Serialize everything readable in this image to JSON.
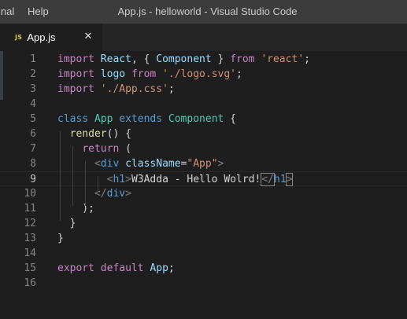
{
  "titlebar": {
    "menu_terminal": "inal",
    "menu_help": "Help",
    "window_title": "App.js - helloworld - Visual Studio Code"
  },
  "tab": {
    "icon_text": "JS",
    "label": "App.js",
    "close_glyph": "✕",
    "icon_color": "#cbcb41"
  },
  "editor": {
    "active_line": 9,
    "lines": [
      {
        "n": "1",
        "tokens": [
          [
            "kw2",
            "import"
          ],
          [
            "p",
            " "
          ],
          [
            "id",
            "React"
          ],
          [
            "p",
            ", { "
          ],
          [
            "id",
            "Component"
          ],
          [
            "p",
            " } "
          ],
          [
            "kw2",
            "from"
          ],
          [
            "p",
            " "
          ],
          [
            "str",
            "'react'"
          ],
          [
            "p",
            ";"
          ]
        ]
      },
      {
        "n": "2",
        "tokens": [
          [
            "kw2",
            "import"
          ],
          [
            "p",
            " "
          ],
          [
            "id",
            "logo"
          ],
          [
            "p",
            " "
          ],
          [
            "kw2",
            "from"
          ],
          [
            "p",
            " "
          ],
          [
            "str",
            "'./logo.svg'"
          ],
          [
            "p",
            ";"
          ]
        ]
      },
      {
        "n": "3",
        "tokens": [
          [
            "kw2",
            "import"
          ],
          [
            "p",
            " "
          ],
          [
            "str",
            "'./App.css'"
          ],
          [
            "p",
            ";"
          ]
        ]
      },
      {
        "n": "4",
        "tokens": []
      },
      {
        "n": "5",
        "tokens": [
          [
            "kw",
            "class"
          ],
          [
            "p",
            " "
          ],
          [
            "cls",
            "App"
          ],
          [
            "p",
            " "
          ],
          [
            "kw",
            "extends"
          ],
          [
            "p",
            " "
          ],
          [
            "cls",
            "Component"
          ],
          [
            "p",
            " {"
          ]
        ]
      },
      {
        "n": "6",
        "tokens": [
          [
            "p",
            "  "
          ],
          [
            "fn",
            "render"
          ],
          [
            "p",
            "() {"
          ]
        ]
      },
      {
        "n": "7",
        "tokens": [
          [
            "p",
            "    "
          ],
          [
            "kw2",
            "return"
          ],
          [
            "p",
            " ("
          ]
        ]
      },
      {
        "n": "8",
        "tokens": [
          [
            "p",
            "      "
          ],
          [
            "br",
            "<"
          ],
          [
            "tag",
            "div"
          ],
          [
            "p",
            " "
          ],
          [
            "attr",
            "className"
          ],
          [
            "p",
            "="
          ],
          [
            "str",
            "\"App\""
          ],
          [
            "br",
            ">"
          ]
        ]
      },
      {
        "n": "9",
        "tokens": [
          [
            "p",
            "        "
          ],
          [
            "br",
            "<"
          ],
          [
            "tag",
            "h1"
          ],
          [
            "br",
            ">"
          ],
          [
            "txt",
            "W3Adda - Hello Wolrd!"
          ],
          [
            "cursor",
            ""
          ],
          [
            "brm",
            "</"
          ],
          [
            "tag",
            "h1"
          ],
          [
            "brm",
            ">"
          ]
        ]
      },
      {
        "n": "10",
        "tokens": [
          [
            "p",
            "      "
          ],
          [
            "br",
            "</"
          ],
          [
            "tag",
            "div"
          ],
          [
            "br",
            ">"
          ]
        ]
      },
      {
        "n": "11",
        "tokens": [
          [
            "p",
            "    );"
          ]
        ]
      },
      {
        "n": "12",
        "tokens": [
          [
            "p",
            "  }"
          ]
        ]
      },
      {
        "n": "13",
        "tokens": [
          [
            "p",
            "}"
          ]
        ]
      },
      {
        "n": "14",
        "tokens": []
      },
      {
        "n": "15",
        "tokens": [
          [
            "kw2",
            "export"
          ],
          [
            "p",
            " "
          ],
          [
            "kw2",
            "default"
          ],
          [
            "p",
            " "
          ],
          [
            "id",
            "App"
          ],
          [
            "p",
            ";"
          ]
        ]
      },
      {
        "n": "16",
        "tokens": []
      }
    ]
  }
}
